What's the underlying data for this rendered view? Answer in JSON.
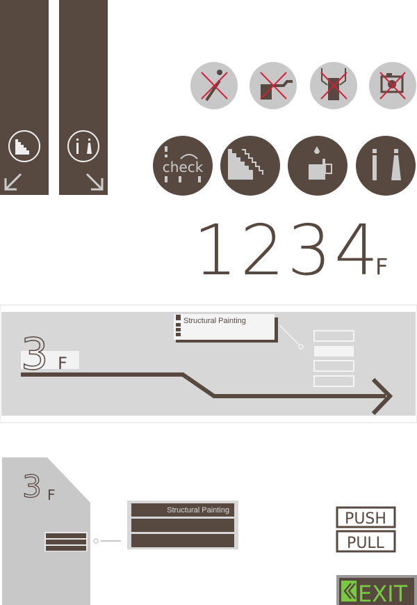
{
  "colors": {
    "brown": "#574840",
    "grey": "#c8c8c8",
    "light_grey": "#d7d7d7",
    "red": "#d0213b",
    "exit_green": "#7ac943",
    "white": "#f4f4f4"
  },
  "banners": [
    {
      "icon": "stairs-icon",
      "arrow": "arrow-down-left-icon"
    },
    {
      "icon": "restroom-icon",
      "arrow": "arrow-down-right-icon"
    }
  ],
  "prohibition_icons": [
    "no-running-icon",
    "no-touching-icon",
    "no-leaning-icon",
    "no-photography-icon"
  ],
  "facility_icons": [
    {
      "icon": "check-in-icon",
      "label": "check"
    },
    {
      "icon": "stairs-icon"
    },
    {
      "icon": "drinks-icon"
    },
    {
      "icon": "restroom-icon"
    }
  ],
  "floor_numbers": {
    "digits": "1234",
    "suffix": "F"
  },
  "floor_guide": {
    "floor": "3",
    "suffix": "F",
    "room_label": "Structural Painting"
  },
  "wall_sign": {
    "floor": "3",
    "suffix": "F",
    "room_label": "Structural Painting"
  },
  "door_signs": {
    "push": "PUSH",
    "pull": "PULL"
  },
  "exit_sign": {
    "label": "EXIT",
    "icon": "double-chevron-left-icon"
  }
}
